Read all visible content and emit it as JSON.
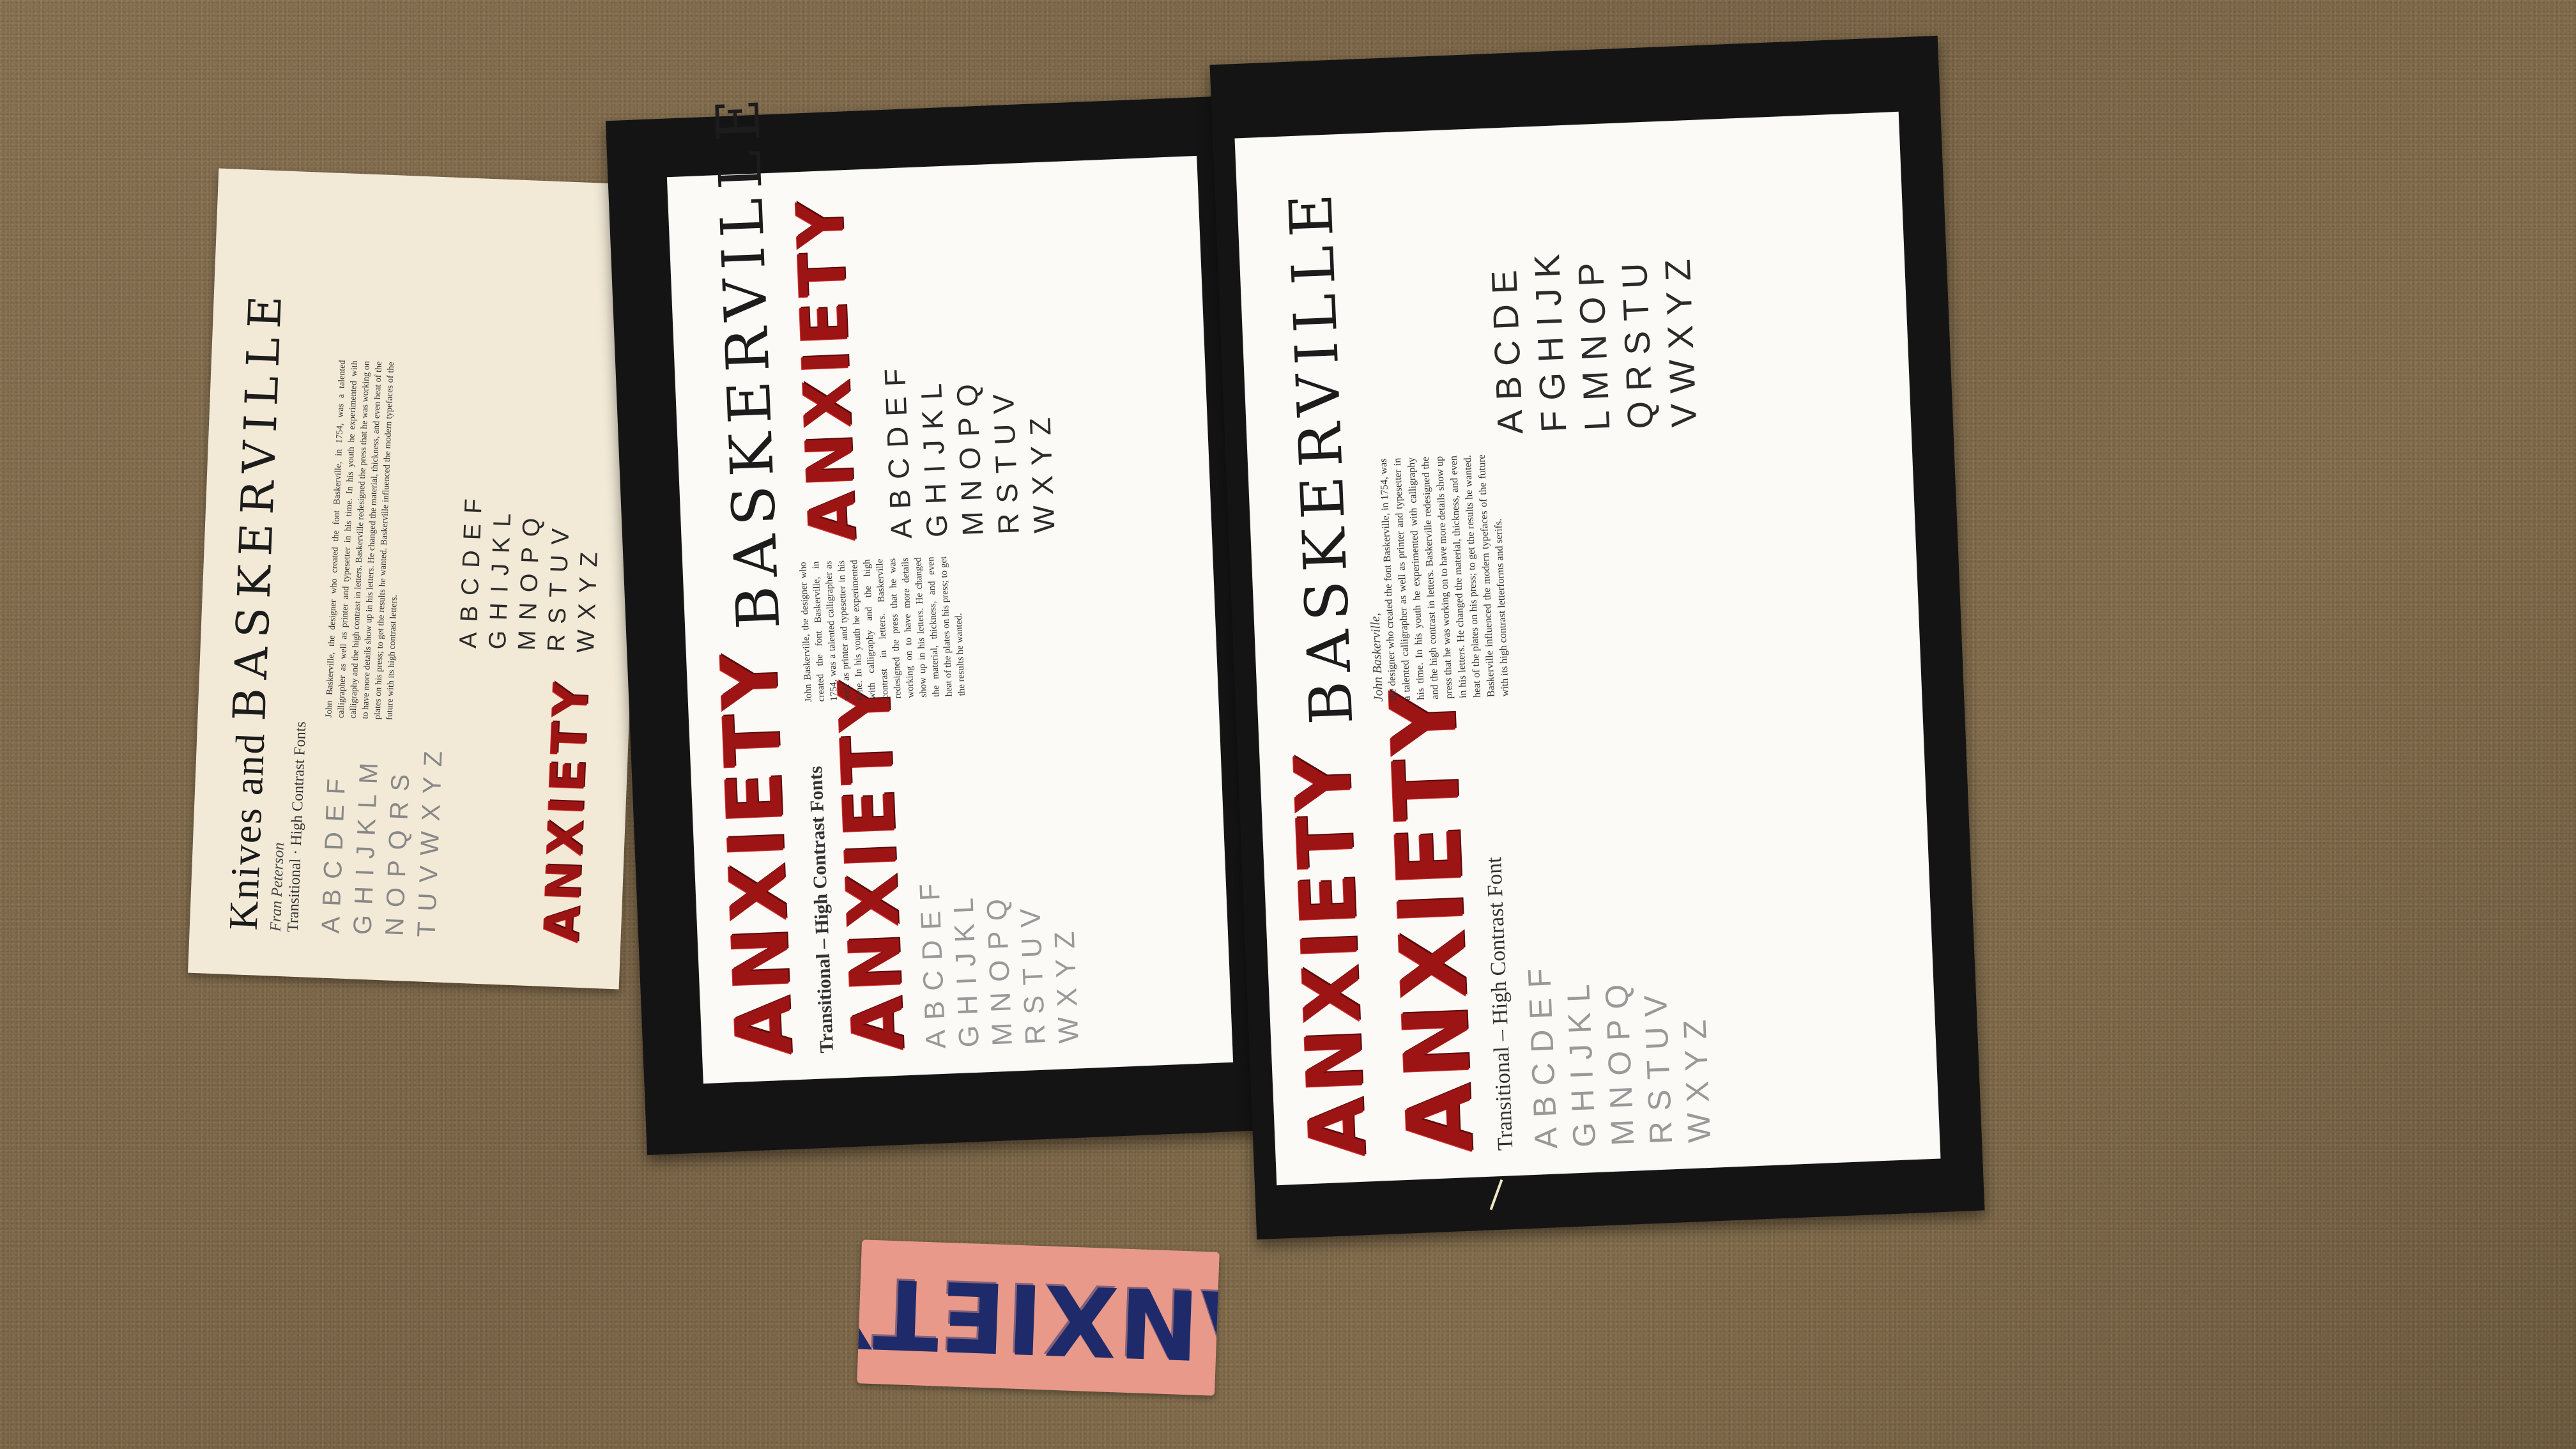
{
  "small_poster": {
    "title": "Knives and",
    "title_font": "BASKERVILLE",
    "author": "Fran Peterson",
    "subtitle": "Transitional · High Contrast Fonts",
    "alphabet_rows": [
      "ABCDEF",
      "GHIJKLM",
      "NOPQRS",
      "TUVWXYZ"
    ],
    "anxiety": "ANXIETY",
    "body": "John Baskerville, the designer who created the font Baskerville, in 1754, was a talented calligrapher as well as printer and typesetter in his time. In his youth he experimented with calligraphy and the high contrast in letters. Baskerville redesigned the press that he was working on to have more details show up in his letters. He changed the material, thickness, and even heat of the plates on his press; to get the results he wanted. Baskerville influenced the modern typefaces of the future with its high contrast letters.",
    "right_alphabet_rows": [
      "ABCDEF",
      "GHIJKL",
      "MNOPQ",
      "RSTUV",
      "WXYZ"
    ]
  },
  "middle_poster": {
    "anxiety_top": "ANXIETY",
    "title_font": "BASKERVILLE",
    "heading": "Transitional – High Contrast Fonts",
    "anxiety_mid": "ANXIETY",
    "anxiety_bottom": "ANXIETY",
    "alphabet_rows": [
      "ABCDEF",
      "GHIJKL",
      "MNOPQ",
      "RSTUV",
      "WXYZ"
    ],
    "right_alphabet_rows": [
      "ABCDEF",
      "GHIJKL",
      "MNOPQ",
      "RSTUV",
      "WXYZ"
    ],
    "body": "John Baskerville, the designer who created the font Baskerville, in 1754, was a talented calligrapher as well as printer and typesetter in his time. In his youth he experimented with calligraphy and the high contrast in letters. Baskerville redesigned the press that he was working on to have more details show up in his letters. He changed the material, thickness, and even heat of the plates on his press; to get the results he wanted."
  },
  "right_poster": {
    "anxiety_top": "ANXIETY",
    "title_font": "BASKERVILLE",
    "anxiety_mid": "ANXIETY",
    "heading": "Transitional – High Contrast Font",
    "author": "John Baskerville,",
    "alphabet_rows": [
      "ABCDEF",
      "GHIJKL",
      "MNOPQ",
      "RSTUV",
      "WXYZ"
    ],
    "right_alphabet_rows": [
      "ABCDE",
      "FGHIJK",
      "LMNOP",
      "QRSTU",
      "VWXYZ"
    ],
    "body": "the designer who created the font Baskerville, in 1754, was a talented calligrapher as well as printer and typesetter in his time. In his youth he experimented with calligraphy and the high contrast in letters. Baskerville redesigned the press that he was working on to have more details show up in his letters. He changed the material, thickness, and even heat of the plates on his press; to get the results he wanted. Baskerville influenced the modern typefaces of the future with its high contrast letterforms and serifs."
  },
  "stamp": {
    "text": "ANXIETY"
  },
  "colors": {
    "carpet": "#7c6749",
    "board": "#141414",
    "blood": "#9c1414",
    "stamp": "#e8998a",
    "ink": "#1e2a6a"
  }
}
